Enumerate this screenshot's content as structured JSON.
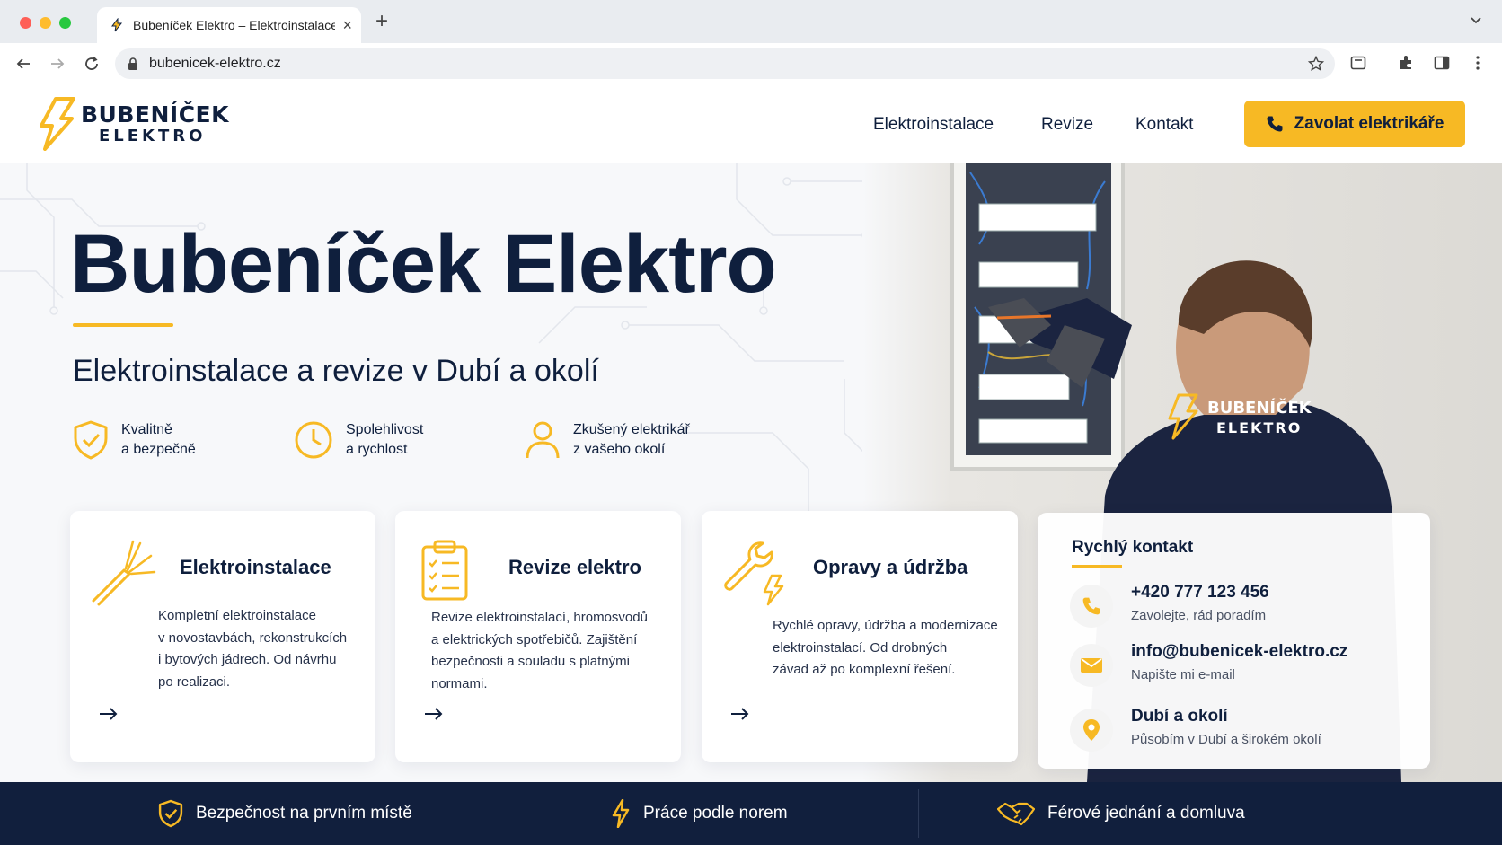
{
  "browser": {
    "tab_title": "Bubeníček Elektro – Elektroinstalace",
    "url": "bubenicek-elektro.cz",
    "icons": [
      "back-icon",
      "forward-icon",
      "reload-icon",
      "lock-icon",
      "bookmark-star-icon",
      "tab-search-icon",
      "extensions-icon",
      "sidebar-icon",
      "more-menu-icon"
    ]
  },
  "header": {
    "logo_line1": "BUBENÍČEK",
    "logo_line2": "ELEKTRO",
    "nav": [
      "Elektroinstalace",
      "Revize",
      "Kontakt"
    ],
    "cta_label": "Zavolat elektrikáře"
  },
  "hero": {
    "title": "Bubeníček Elektro",
    "subtitle": "Elektroinstalace a revize v Dubí a okolí",
    "features": [
      {
        "icon": "shield-check-icon",
        "line1": "Kvalitně",
        "line2": "a bezpečně"
      },
      {
        "icon": "clock-icon",
        "line1": "Spolehlivost",
        "line2": "a rychlost"
      },
      {
        "icon": "user-icon",
        "line1": "Zkušený elektrikář",
        "line2": "z vašeho okolí"
      }
    ],
    "jacket_logo_line1": "BUBENÍČEK",
    "jacket_logo_line2": "ELEKTRO"
  },
  "services": [
    {
      "icon": "cable-icon",
      "title": "Elektroinstalace",
      "lines": [
        "Kompletní elektroinstalace",
        "v novostavbách, rekonstrukcích",
        "i bytových jádrech. Od návrhu",
        "po realizaci."
      ]
    },
    {
      "icon": "clipboard-checklist-icon",
      "title": "Revize elektro",
      "lines": [
        "Revize elektroinstalací, hromosvodů",
        "a elektrických spotřebičů. Zajištění",
        "bezpečnosti a souladu s platnými",
        "normami."
      ]
    },
    {
      "icon": "wrench-bolt-icon",
      "title": "Opravy a údržba",
      "lines": [
        "Rychlé opravy, údržba a modernizace",
        "elektroinstalací. Od drobných",
        "závad až po komplexní řešení."
      ]
    }
  ],
  "quick_contact": {
    "title": "Rychlý kontakt",
    "items": [
      {
        "icon": "phone-icon",
        "main": "+420 777 123 456",
        "sub": "Zavolejte, rád poradím"
      },
      {
        "icon": "mail-icon",
        "main": "info@bubenicek-elektro.cz",
        "sub": "Napište mi e-mail"
      },
      {
        "icon": "map-pin-icon",
        "main": "Dubí a okolí",
        "sub": "Působím v Dubí a širokém okolí"
      }
    ]
  },
  "band": [
    {
      "icon": "shield-check-icon",
      "label": "Bezpečnost na prvním místě"
    },
    {
      "icon": "bolt-icon",
      "label": "Práce podle norem"
    },
    {
      "icon": "handshake-icon",
      "label": "Férové jednání a domluva"
    }
  ],
  "colors": {
    "accent": "#f7b924",
    "navy": "#0f1f3d",
    "band": "#111f3d"
  }
}
